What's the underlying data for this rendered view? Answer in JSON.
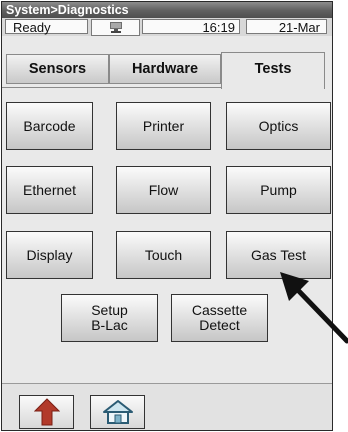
{
  "header": {
    "title": "System>Diagnostics"
  },
  "status_bar": {
    "status": "Ready",
    "network_icon": "network-icon",
    "time": "16:19",
    "date": "21-Mar"
  },
  "tabs": [
    {
      "label": "Sensors",
      "active": false
    },
    {
      "label": "Hardware",
      "active": false
    },
    {
      "label": "Tests",
      "active": true
    }
  ],
  "test_buttons": {
    "barcode": "Barcode",
    "printer": "Printer",
    "optics": "Optics",
    "ethernet": "Ethernet",
    "flow": "Flow",
    "pump": "Pump",
    "display": "Display",
    "touch": "Touch",
    "gas_test": "Gas Test",
    "setup_line1": "Setup",
    "setup_line2": "B-Lac",
    "cassette_line1": "Cassette",
    "cassette_line2": "Detect"
  },
  "nav": {
    "back_icon": "up-arrow-icon",
    "home_icon": "home-icon"
  },
  "colors": {
    "title_bar": "#5f5f5f",
    "background": "#e9e9e9",
    "arrow_red": "#c62828"
  }
}
